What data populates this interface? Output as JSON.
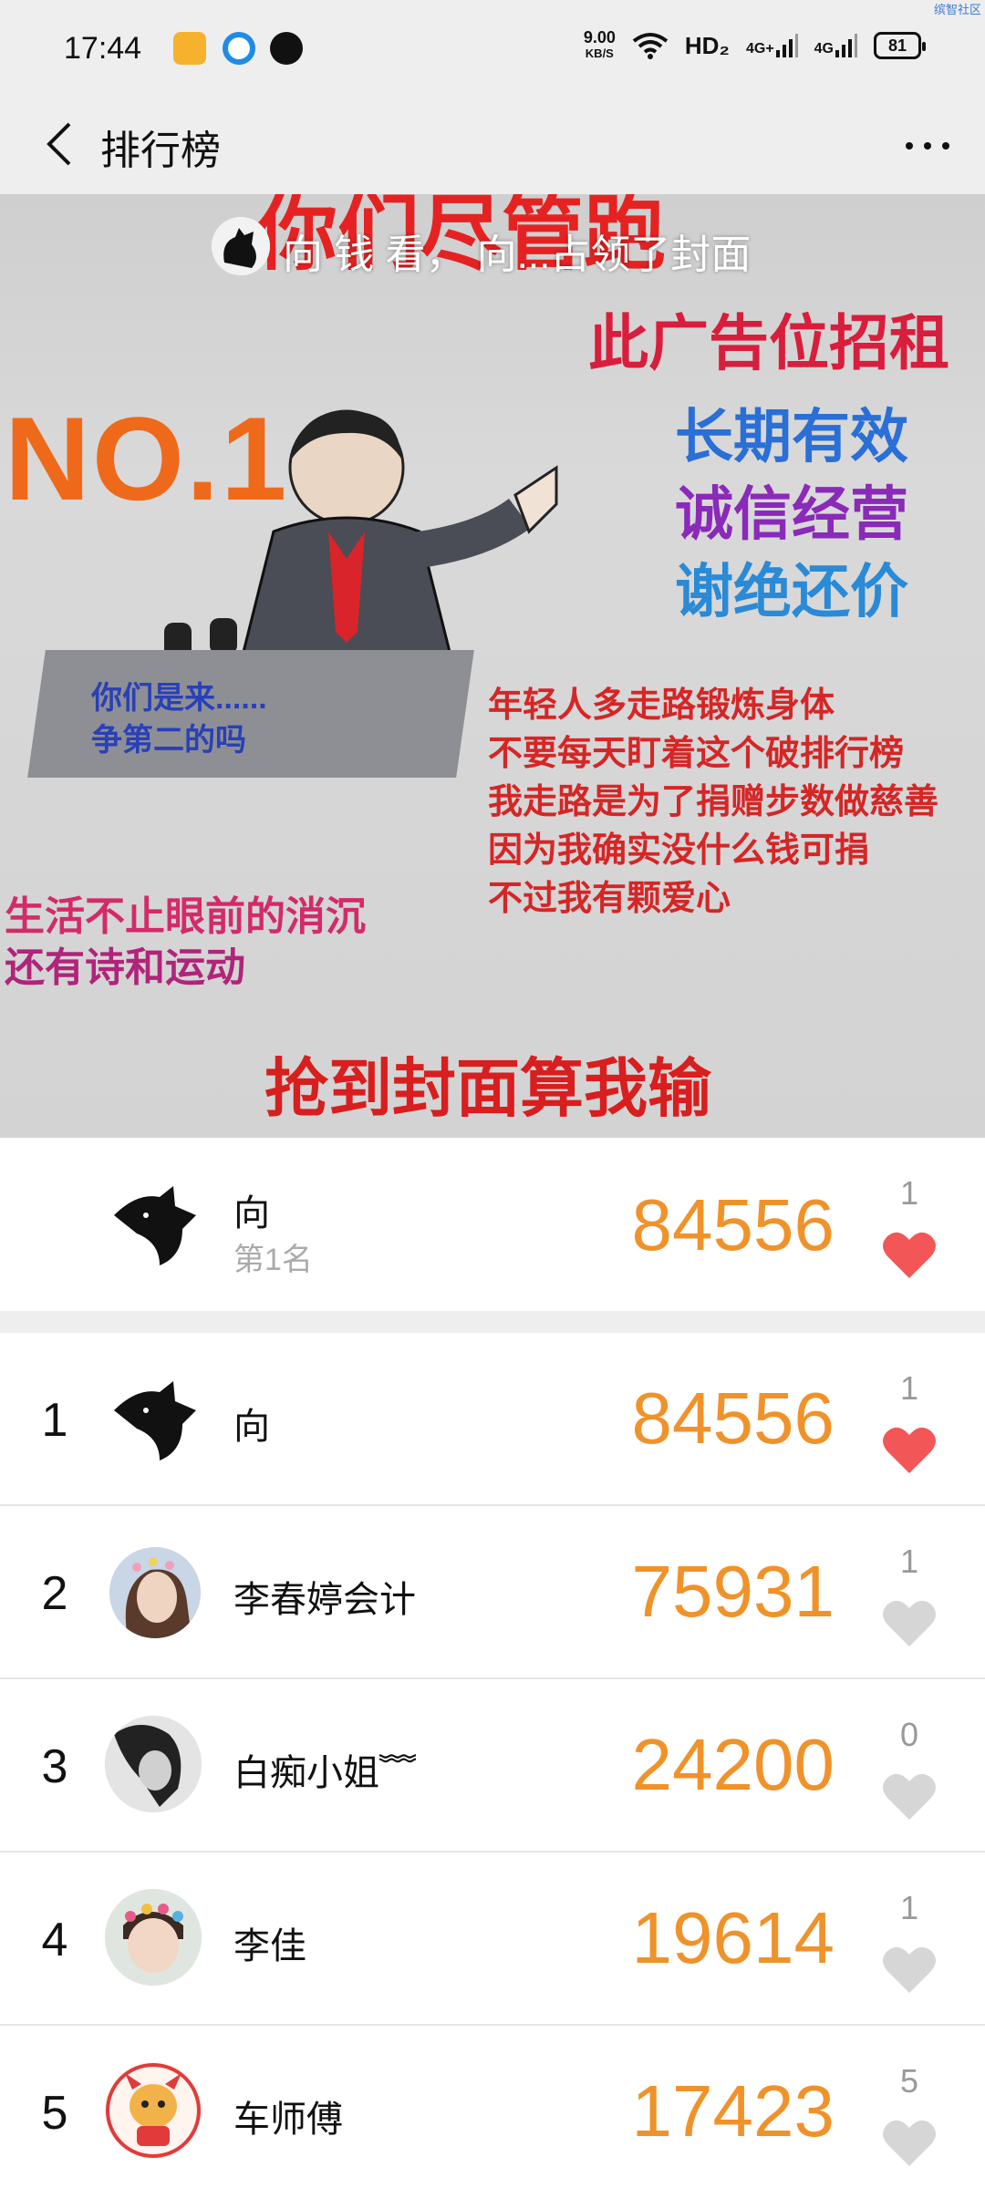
{
  "status_bar": {
    "time": "17:44",
    "speed_value": "9.00",
    "speed_unit": "KB/S",
    "network": "HD₂",
    "sig1": "4G+",
    "sig2": "4G",
    "battery": "81",
    "watermark": "缤智社区"
  },
  "header": {
    "title": "排行榜"
  },
  "cover": {
    "caption": "向 钱 看， 向...占领了封面",
    "top_text": "你们尽管跑",
    "ad_text": "此广告位招租",
    "no1": "NO.1",
    "slogans": [
      "长期有效",
      "诚信经营",
      "谢绝还价"
    ],
    "podium_lines": [
      "你们是来......",
      "争第二的吗"
    ],
    "right_lines": [
      "年轻人多走路锻炼身体",
      "不要每天盯着这个破排行榜",
      "我走路是为了捐赠步数做慈善",
      "因为我确实没什么钱可捐",
      "不过我有颗爱心"
    ],
    "left_lines": [
      "生活不止眼前的消沉",
      "还有诗和运动"
    ],
    "bottom_text": "抢到封面算我输"
  },
  "me": {
    "name": "向",
    "rank_label": "第1名",
    "steps": "84556",
    "likes": "1",
    "liked": true
  },
  "ranking": [
    {
      "rank": "1",
      "name": "向",
      "steps": "84556",
      "likes": "1",
      "liked": true
    },
    {
      "rank": "2",
      "name": "李春婷会计",
      "steps": "75931",
      "likes": "1",
      "liked": false
    },
    {
      "rank": "3",
      "name": "白痴小姐﹌",
      "steps": "24200",
      "likes": "0",
      "liked": false
    },
    {
      "rank": "4",
      "name": "李佳",
      "steps": "19614",
      "likes": "1",
      "liked": false
    },
    {
      "rank": "5",
      "name": "车师傅",
      "steps": "17423",
      "likes": "5",
      "liked": false
    }
  ],
  "colors": {
    "steps": "#f0922a",
    "heart_on": "#f25656",
    "heart_off": "#d6d6d6"
  }
}
